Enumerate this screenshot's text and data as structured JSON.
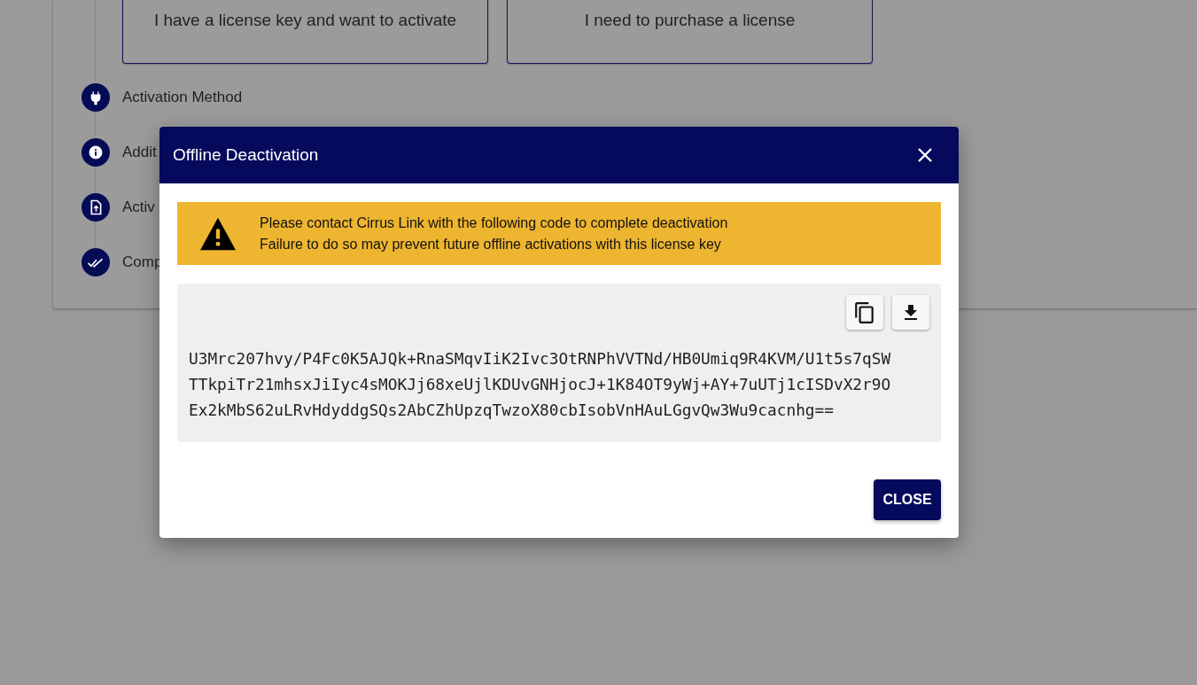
{
  "choices": [
    {
      "label": "I have a license key and want to activate"
    },
    {
      "label": "I need to purchase a license"
    }
  ],
  "steps": [
    {
      "kind": "plug",
      "label": "Activation Method"
    },
    {
      "kind": "info",
      "label": "Addit"
    },
    {
      "kind": "file",
      "label": "Activ"
    },
    {
      "kind": "done",
      "label": "Comp"
    }
  ],
  "dialog": {
    "title": "Offline Deactivation",
    "alert": {
      "lines": [
        "Please contact Cirrus Link with the following code to complete deactivation",
        "Failure to do so may prevent future offline activations with this license key"
      ]
    },
    "code_lines": [
      "U3Mrc207hvy/P4Fc0K5AJQk+RnaSMqvIiK2Ivc3OtRNPhVVTNd/HB0Umiq9R4KVM/U1t5s7qSW",
      "TTkpiTr21mhsxJiIyc4sMOKJj68xeUjlKDUvGNHjocJ+1K84OT9yWj+AY+7uUTj1cISDvX2r9O",
      "Ex2kMbS62uLRvHdyddgSQs2AbCZhUpzqTwzoX80cbIsobVnHAuLGgvQw3Wu9cacnhg=="
    ],
    "close_button": "CLOSE"
  }
}
